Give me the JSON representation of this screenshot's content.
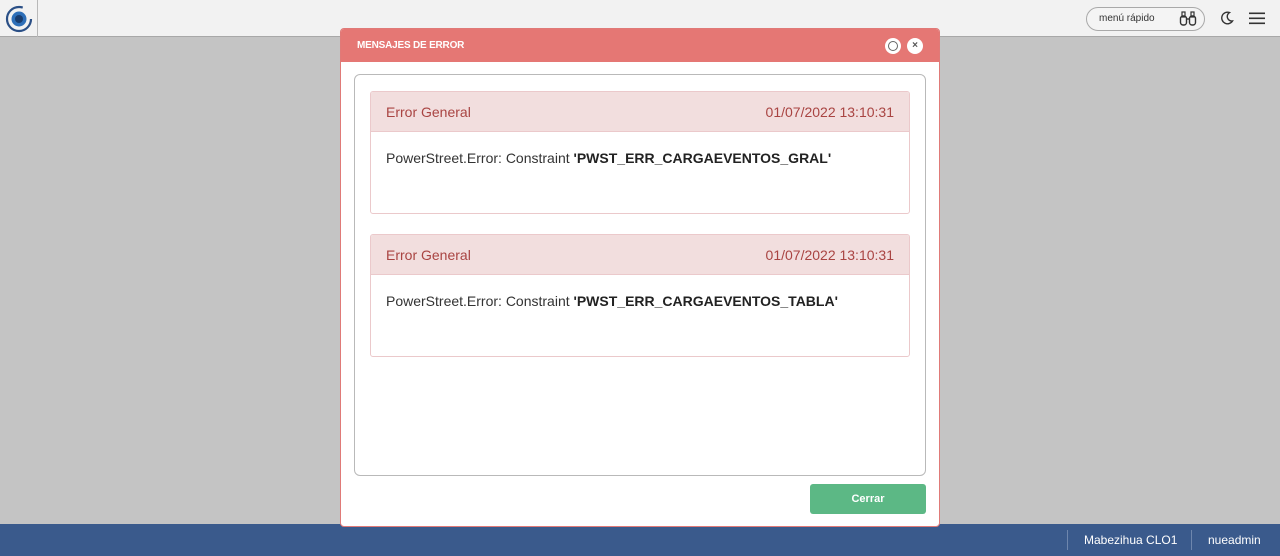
{
  "topbar": {
    "logo_icon": "app-logo-icon",
    "quick_menu_label": "menú rápido",
    "quick_menu_icon": "binoculars-icon",
    "theme_icon": "moon-icon",
    "menu_icon": "hamburger-icon"
  },
  "modal": {
    "title": "MENSAJES DE ERROR",
    "restore_icon": "restore-icon",
    "close_symbol": "×",
    "errors": [
      {
        "type": "Error General",
        "timestamp": "01/07/2022 13:10:31",
        "message_prefix": "PowerStreet.Error: Constraint ",
        "constraint": "'PWST_ERR_CARGAEVENTOS_GRAL'"
      },
      {
        "type": "Error General",
        "timestamp": "01/07/2022 13:10:31",
        "message_prefix": "PowerStreet.Error: Constraint ",
        "constraint": "'PWST_ERR_CARGAEVENTOS_TABLA'"
      }
    ],
    "close_button_label": "Cerrar"
  },
  "footer": {
    "company": "Mabezihua CLO1",
    "user": "nueadmin"
  },
  "colors": {
    "header_red": "#e57774",
    "error_bg": "#f2dede",
    "error_text": "#a94442",
    "button_green": "#5cb885",
    "footer_blue": "#3a5a8c"
  }
}
